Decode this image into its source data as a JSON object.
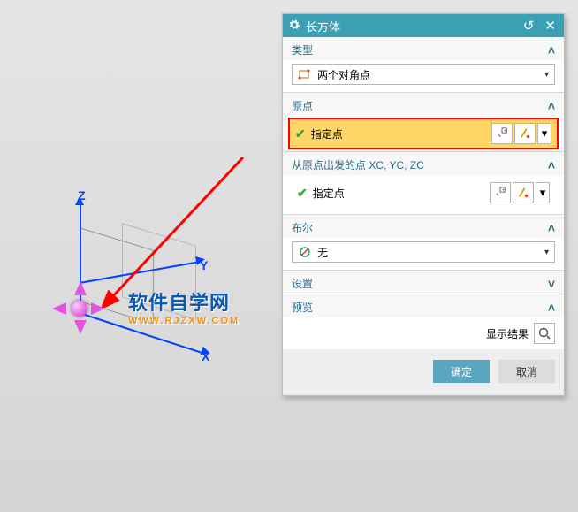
{
  "viewport": {
    "axis_x": "X",
    "axis_y": "Y",
    "axis_z": "Z"
  },
  "watermark": {
    "text": "软件自学网",
    "url": "WWW.RJZXW.COM"
  },
  "dialog": {
    "title": "长方体",
    "gear_icon": "gear-icon",
    "reset_icon": "reset-icon",
    "close_icon": "close-icon",
    "sections": {
      "type": {
        "label": "类型",
        "combo_value": "两个对角点",
        "combo_icon": "two-corner-points-icon"
      },
      "origin": {
        "label": "原点",
        "field_label": "指定点",
        "pickpoint_btn": "point-picker-button",
        "cursor_btn": "cursor-pick-button",
        "dropdown_btn": "dropdown-button"
      },
      "second_point": {
        "label": "从原点出发的点 XC, YC, ZC",
        "field_label": "指定点",
        "pickpoint_btn": "point-picker-button",
        "cursor_btn": "cursor-pick-button",
        "dropdown_btn": "dropdown-button"
      },
      "boolean": {
        "label": "布尔",
        "combo_value": "无",
        "combo_icon": "boolean-none-icon"
      },
      "settings": {
        "label": "设置"
      },
      "preview": {
        "label": "预览",
        "show_result_label": "显示结果",
        "magnify_btn": "magnify-button"
      }
    },
    "buttons": {
      "ok": "确定",
      "cancel": "取消"
    }
  }
}
